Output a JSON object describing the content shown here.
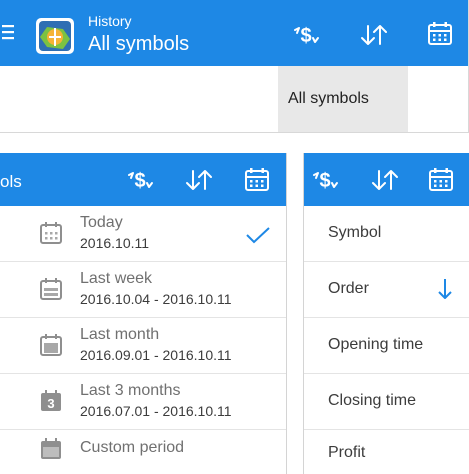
{
  "top": {
    "header_title": "History",
    "header_subtitle": "All symbols",
    "dropdown_item": "All symbols"
  },
  "left": {
    "header_partial_title": "ols",
    "periods": [
      {
        "label": "Today",
        "range": "2016.10.11",
        "selected": true
      },
      {
        "label": "Last week",
        "range": "2016.10.04 - 2016.10.11"
      },
      {
        "label": "Last month",
        "range": "2016.09.01 - 2016.10.11"
      },
      {
        "label": "Last 3 months",
        "range": "2016.07.01 - 2016.10.11",
        "icon_digit": "3"
      },
      {
        "label": "Custom period"
      }
    ]
  },
  "right": {
    "sort_items": [
      {
        "label": "Symbol"
      },
      {
        "label": "Order",
        "sorted": "descending"
      },
      {
        "label": "Opening time"
      },
      {
        "label": "Closing time"
      },
      {
        "label": "Profit"
      }
    ]
  },
  "colors": {
    "header": "#1e88e5",
    "accent": "#1e88e5",
    "text": "#3c3c3c",
    "secondary": "#707070"
  },
  "icons": [
    "menu-icon",
    "app-logo-icon",
    "symbol-filter-icon",
    "sort-icon",
    "calendar-icon",
    "checkmark-icon",
    "arrow-down-icon"
  ]
}
